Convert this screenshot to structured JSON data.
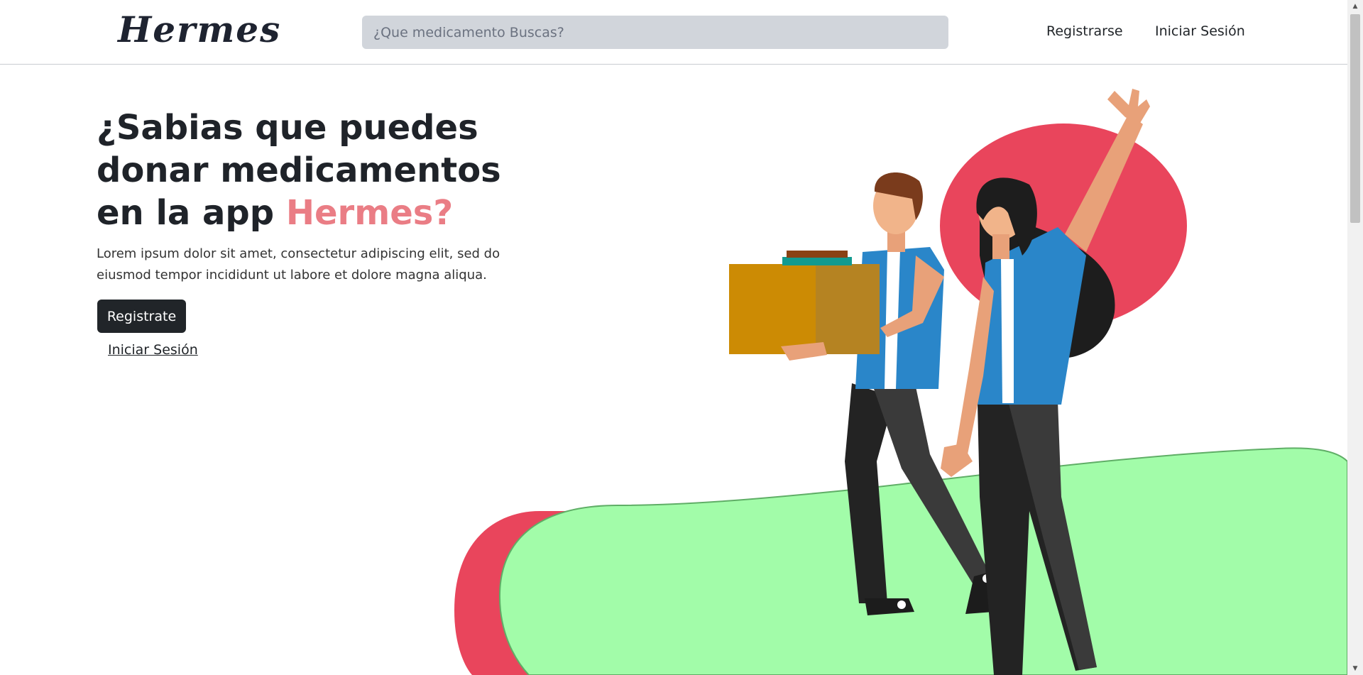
{
  "header": {
    "logo": "Hermes",
    "search_placeholder": "¿Que medicamento Buscas?",
    "nav": {
      "register": "Registrarse",
      "login": "Iniciar Sesión"
    }
  },
  "hero": {
    "title_main": "¿Sabias que puedes donar medicamentos en la app ",
    "title_accent": "Hermes?",
    "description": "Lorem ipsum dolor sit amet, consectetur adipiscing elit, sed do eiusmod tempor incididunt ut labore et dolore magna aliqua.",
    "cta_button": "Registrate",
    "login_link": "Iniciar Sesión"
  },
  "colors": {
    "accent": "#ea7d85",
    "dark": "#212529",
    "search_bg": "#d1d5db",
    "blob_red": "#e9455c",
    "blob_green": "#a2fca9"
  },
  "illustration": {
    "icon": "people-donating-box-illustration"
  },
  "scrollbar": {
    "up_icon": "▲",
    "down_icon": "▼"
  }
}
